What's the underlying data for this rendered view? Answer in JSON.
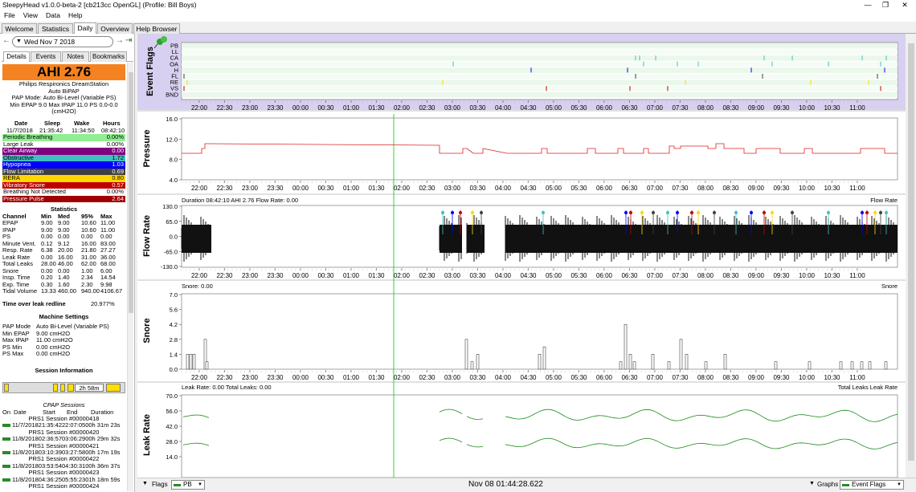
{
  "window": {
    "title": "SleepyHead v1.0.0-beta-2 [cb213cc OpenGL] (Profile: Bill Boys)",
    "minimize": "—",
    "maximize": "❐",
    "close": "✕"
  },
  "menu": [
    "File",
    "View",
    "Data",
    "Help"
  ],
  "tabs": [
    "Welcome",
    "Statistics",
    "Daily",
    "Overview",
    "Help Browser"
  ],
  "date_nav": {
    "date": "Wed Nov 7 2018",
    "prev": "←",
    "next": "→",
    "jump": "⇥"
  },
  "subtabs": [
    "Details",
    "Events",
    "Notes",
    "Bookmarks"
  ],
  "ahi": {
    "label": "AHI 2.76"
  },
  "machine_header": [
    "Philips Respironics DreamStation",
    "Auto BiPAP",
    "PAP Mode: Auto Bi-Level (Variable PS)",
    "Min EPAP 9.0 Max IPAP 11.0 PS 0.0-0.0",
    "(cmH2O)"
  ],
  "session_summary": {
    "headers": [
      "Date",
      "Sleep",
      "Wake",
      "Hours"
    ],
    "values": [
      "11/7/2018",
      "21:35:42",
      "11:34:50",
      "08:42:10"
    ]
  },
  "indices": [
    {
      "name": "Periodic Breathing",
      "value": "0.00%",
      "color": "#90ee90",
      "text": "#000"
    },
    {
      "name": "Large Leak",
      "value": "0.00%",
      "color": "#ffffff",
      "text": "#000"
    },
    {
      "name": "Clear Airway",
      "value": "0.00",
      "color": "#800080",
      "text": "#fff"
    },
    {
      "name": "Obstructive",
      "value": "1.72",
      "color": "#40c0c0",
      "text": "#000"
    },
    {
      "name": "Hypopnea",
      "value": "1.03",
      "color": "#0000ff",
      "text": "#fff"
    },
    {
      "name": "Flow Limitation",
      "value": "0.69",
      "color": "#404040",
      "text": "#fff"
    },
    {
      "name": "RERA",
      "value": "0.80",
      "color": "#ffd700",
      "text": "#000"
    },
    {
      "name": "Vibratory Snore",
      "value": "0.57",
      "color": "#c00000",
      "text": "#fff"
    },
    {
      "name": "Breathing Not Detected",
      "value": "0.00%",
      "color": "#ffffff",
      "text": "#000"
    },
    {
      "name": "Pressure Pulse",
      "value": "2.64",
      "color": "#a00000",
      "text": "#fff"
    }
  ],
  "statistics": {
    "title": "Statistics",
    "headers": [
      "Channel",
      "Min",
      "Med",
      "95%",
      "Max"
    ],
    "rows": [
      [
        "EPAP",
        "9.00",
        "9.00",
        "10.60",
        "11.00"
      ],
      [
        "IPAP",
        "9.00",
        "9.00",
        "10.60",
        "11.00"
      ],
      [
        "PS",
        "0.00",
        "0.00",
        "0.00",
        "0.00"
      ],
      [
        "Minute Vent.",
        "0.12",
        "9.12",
        "16.00",
        "83.00"
      ],
      [
        "Resp. Rate",
        "6.38",
        "20.00",
        "21.80",
        "27.27"
      ],
      [
        "Leak Rate",
        "0.00",
        "16.00",
        "31.00",
        "36.00"
      ],
      [
        "Total Leaks",
        "28.00",
        "46.00",
        "62.00",
        "68.00"
      ],
      [
        "Snore",
        "0.00",
        "0.00",
        "1.00",
        "6.00"
      ],
      [
        "Insp. Time",
        "0.20",
        "1.40",
        "2.34",
        "14.54"
      ],
      [
        "Exp. Time",
        "0.30",
        "1.60",
        "2.30",
        "9.98"
      ],
      [
        "Tidal Volume",
        "13.33",
        "460.00",
        "940.00",
        "4106.67"
      ]
    ],
    "leak_label": "Time over leak redline",
    "leak_value": "20.977%"
  },
  "machine_settings": {
    "title": "Machine Settings",
    "rows": [
      [
        "PAP Mode",
        "Auto Bi-Level (Variable PS)"
      ],
      [
        "Min EPAP",
        "9.00 cmH2O"
      ],
      [
        "Max IPAP",
        "11.00 cmH2O"
      ],
      [
        "PS Min",
        "0.00 cmH2O"
      ],
      [
        "PS Max",
        "0.00 cmH2O"
      ]
    ]
  },
  "session_info": {
    "title": "Session Information",
    "bar_label": "2h 58m",
    "cpap_title": "CPAP Sessions",
    "headers": [
      "On",
      "Date",
      "Start",
      "End",
      "Duration"
    ],
    "sessions": [
      {
        "name": "PRS1 Session #00000418",
        "line": "11/7/201821:35:4222:07:0500h 31m 23s"
      },
      {
        "name": "PRS1 Session #00000420",
        "line": "11/8/201802:36:5703:06:2900h 29m 32s"
      },
      {
        "name": "PRS1 Session #00000421",
        "line": "11/8/201803:10:3903:27:5800h 17m 19s"
      },
      {
        "name": "PRS1 Session #00000422",
        "line": "11/8/201803:53:5404:30:3100h 36m 37s"
      },
      {
        "name": "PRS1 Session #00000423",
        "line": "11/8/201804:36:2505:55:2301h 18m 59s"
      },
      {
        "name": "PRS1 Session #00000424",
        "line": ""
      }
    ]
  },
  "time_axis": [
    "22:00",
    "22:30",
    "23:00",
    "23:30",
    "00:00",
    "00:30",
    "01:00",
    "01:30",
    "02:00",
    "02:30",
    "03:00",
    "03:30",
    "04:00",
    "04:30",
    "05:00",
    "05:30",
    "06:00",
    "06:30",
    "07:00",
    "07:30",
    "08:00",
    "08:30",
    "09:00",
    "09:30",
    "10:00",
    "10:30",
    "11:00"
  ],
  "event_flags": {
    "ylabel": "Event Flags",
    "rows": [
      "PB",
      "LL",
      "CA",
      "OA",
      "H",
      "FL",
      "RE",
      "VS",
      "BND"
    ]
  },
  "pressure": {
    "ylabel": "Pressure",
    "ticks": [
      "16.0",
      "12.0",
      "8.0",
      "4.0"
    ]
  },
  "flow": {
    "ylabel": "Flow Rate",
    "info": "Duration 08:42:10 AHI 2.76 Flow Rate: 0.00",
    "legend": "Flow Rate",
    "ticks": [
      "130.0",
      "65.0",
      "0.0",
      "-65.0",
      "-130.0"
    ]
  },
  "snore": {
    "ylabel": "Snore",
    "info": "Snore: 0.00",
    "legend": "Snore",
    "ticks": [
      "7.0",
      "5.6",
      "4.2",
      "2.8",
      "1.4",
      "0.0"
    ]
  },
  "leak": {
    "ylabel": "Leak Rate",
    "info": "Leak Rate: 0.00 Total Leaks: 0.00",
    "legend1": "Total Leaks",
    "legend2": "Leak Rate",
    "ticks": [
      "70.0",
      "56.0",
      "42.0",
      "28.0",
      "14.0"
    ]
  },
  "status": {
    "flags_label": "Flags",
    "pb_label": "PB",
    "timestamp": "Nov 08 01:44:28.622",
    "graphs_label": "Graphs",
    "event_flags_label": "Event Flags"
  },
  "colors": {
    "ahi_bg": "#f58220",
    "pressure_line": "#e02020",
    "leak_line": "#1a8a1a",
    "cursor": "#00cc00",
    "flag_panel": "#d8d0f0"
  }
}
